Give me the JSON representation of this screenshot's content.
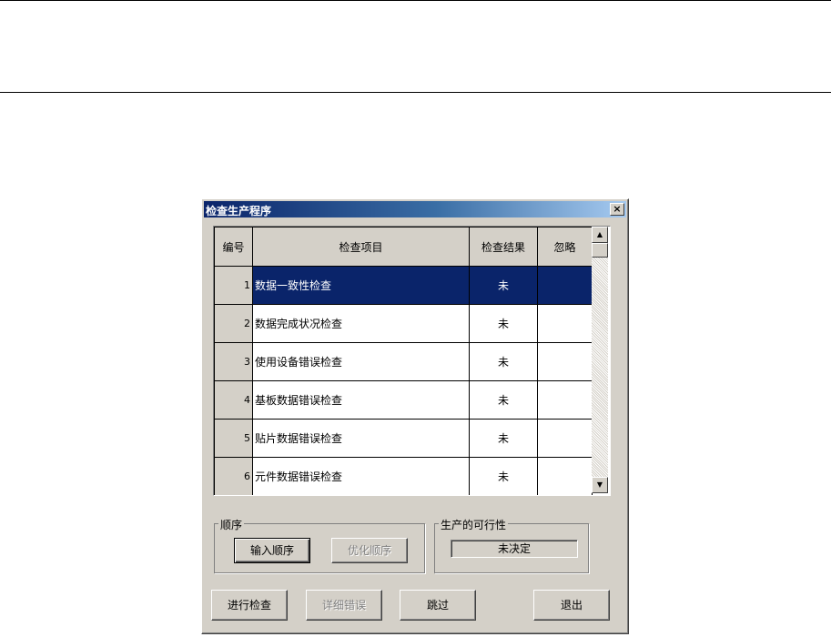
{
  "dialog": {
    "title": "检查生产程序",
    "close_label": "×"
  },
  "grid": {
    "headers": {
      "number": "编号",
      "item": "检查项目",
      "result": "检查结果",
      "ignore": "忽略"
    },
    "rows": [
      {
        "number": "1",
        "item": "数据一致性检查",
        "result": "未",
        "ignore": "",
        "selected": true
      },
      {
        "number": "2",
        "item": "数据完成状况检查",
        "result": "未",
        "ignore": ""
      },
      {
        "number": "3",
        "item": "使用设备错误检查",
        "result": "未",
        "ignore": ""
      },
      {
        "number": "4",
        "item": "基板数据错误检查",
        "result": "未",
        "ignore": ""
      },
      {
        "number": "5",
        "item": "贴片数据错误检查",
        "result": "未",
        "ignore": ""
      },
      {
        "number": "6",
        "item": "元件数据错误检查",
        "result": "未",
        "ignore": ""
      }
    ],
    "scroll_up_icon": "▲",
    "scroll_down_icon": "▼"
  },
  "order_group": {
    "label": "顺序",
    "input_order_label": "输入顺序",
    "optimize_order_label": "优化顺序"
  },
  "feasibility_group": {
    "label": "生产的可行性",
    "status": "未决定"
  },
  "actions": {
    "run_check_label": "进行检查",
    "error_details_label": "详细错误",
    "skip_label": "跳过",
    "exit_label": "退出"
  }
}
